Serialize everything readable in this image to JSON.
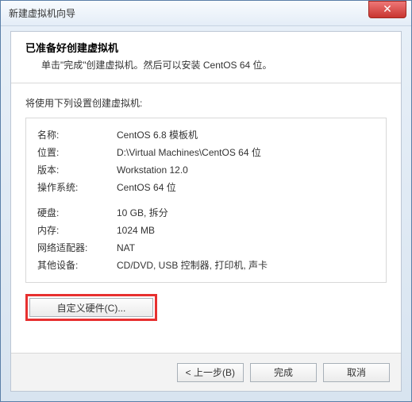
{
  "window": {
    "title": "新建虚拟机向导",
    "close": "✕"
  },
  "header": {
    "title": "已准备好创建虚拟机",
    "subtitle": "单击\"完成\"创建虚拟机。然后可以安装 CentOS 64 位。"
  },
  "body": {
    "intro": "将使用下列设置创建虚拟机:",
    "rows": {
      "name_label": "名称:",
      "name_value": "CentOS 6.8 模板机",
      "location_label": "位置:",
      "location_value": "D:\\Virtual Machines\\CentOS 64 位",
      "version_label": "版本:",
      "version_value": "Workstation 12.0",
      "os_label": "操作系统:",
      "os_value": "CentOS 64 位",
      "disk_label": "硬盘:",
      "disk_value": "10 GB, 拆分",
      "memory_label": "内存:",
      "memory_value": "1024 MB",
      "network_label": "网络适配器:",
      "network_value": "NAT",
      "other_label": "其他设备:",
      "other_value": "CD/DVD, USB 控制器, 打印机, 声卡"
    },
    "customize_hw": "自定义硬件(C)..."
  },
  "footer": {
    "back": "< 上一步(B)",
    "finish": "完成",
    "cancel": "取消"
  }
}
